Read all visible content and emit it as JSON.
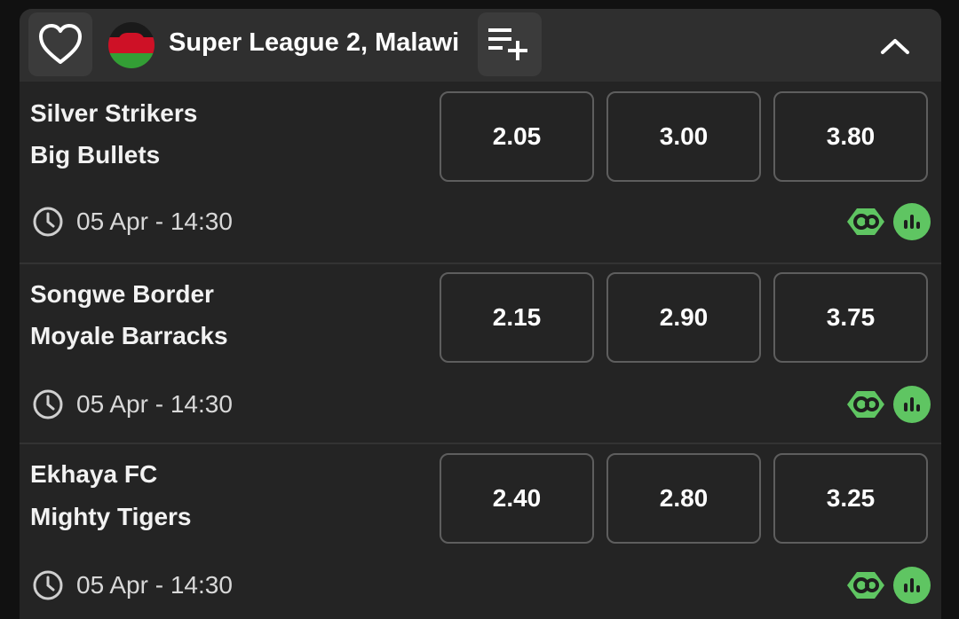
{
  "header": {
    "league_title": "Super League 2, Malawi",
    "favorite_icon": "heart-outline-icon",
    "flag": {
      "country": "Malawi",
      "colors": [
        "#000000",
        "#ce1126",
        "#339e35"
      ]
    },
    "add_icon": "playlist-add-icon",
    "collapse_icon": "chevron-up-icon"
  },
  "colors": {
    "background": "#111111",
    "panel": "#242424",
    "header": "#2f2f2f",
    "odds_border": "#5e5e5e",
    "accent_green": "#5fc562"
  },
  "matches": [
    {
      "home": "Silver Strikers",
      "away": "Big Bullets",
      "odds": [
        "2.05",
        "3.00",
        "3.80"
      ],
      "time": "05 Apr - 14:30",
      "icons": [
        "clock-icon",
        "live-stream-icon",
        "stats-icon"
      ]
    },
    {
      "home": "Songwe Border",
      "away": "Moyale Barracks",
      "odds": [
        "2.15",
        "2.90",
        "3.75"
      ],
      "time": "05 Apr - 14:30",
      "icons": [
        "clock-icon",
        "live-stream-icon",
        "stats-icon"
      ]
    },
    {
      "home": "Ekhaya FC",
      "away": "Mighty Tigers",
      "odds": [
        "2.40",
        "2.80",
        "3.25"
      ],
      "time": "05 Apr - 14:30",
      "icons": [
        "clock-icon",
        "live-stream-icon",
        "stats-icon"
      ]
    }
  ]
}
